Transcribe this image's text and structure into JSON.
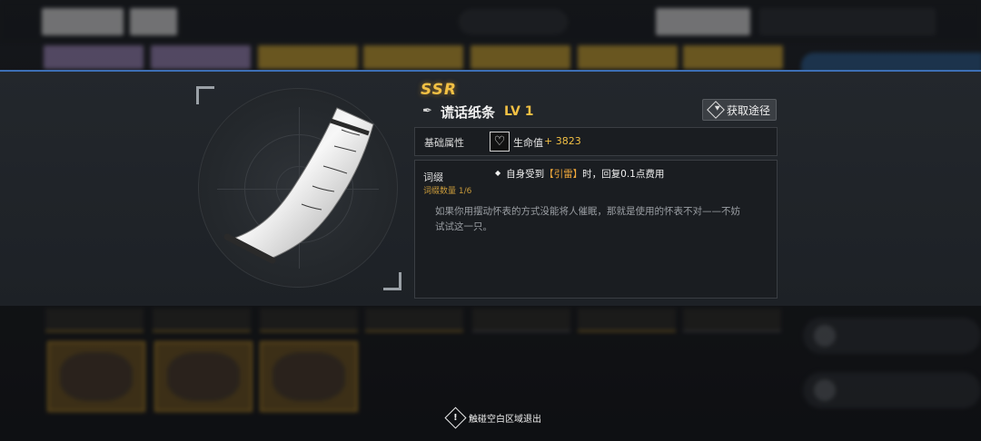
{
  "item": {
    "rarity": "SSR",
    "name": "谎话纸条",
    "level": "LV 1",
    "icon": "pen-icon"
  },
  "acquire_button": {
    "label": "获取途径",
    "icon": "acquire-diamond-icon"
  },
  "base_attributes": {
    "label": "基础属性",
    "stat_icon": "heart-icon",
    "stat_name": "生命值",
    "stat_value": "+ 3823"
  },
  "affix": {
    "label": "词缀",
    "count": "词缀数量 1/6",
    "effect_prefix": "自身受到",
    "effect_highlight": "【引雷】",
    "effect_suffix": "时，回复0.1点费用",
    "flavor_text": "如果你用摆动怀表的方式没能将人催眠，那就是使用的怀表不对——不妨试试这一只。"
  },
  "exit_hint": {
    "label": "触碰空白区域退出",
    "icon": "exclamation-diamond-icon"
  },
  "colors": {
    "accent_gold": "#f2c044",
    "highlight_orange": "#f2a93b",
    "panel_border_blue": "#3d6fb5"
  }
}
